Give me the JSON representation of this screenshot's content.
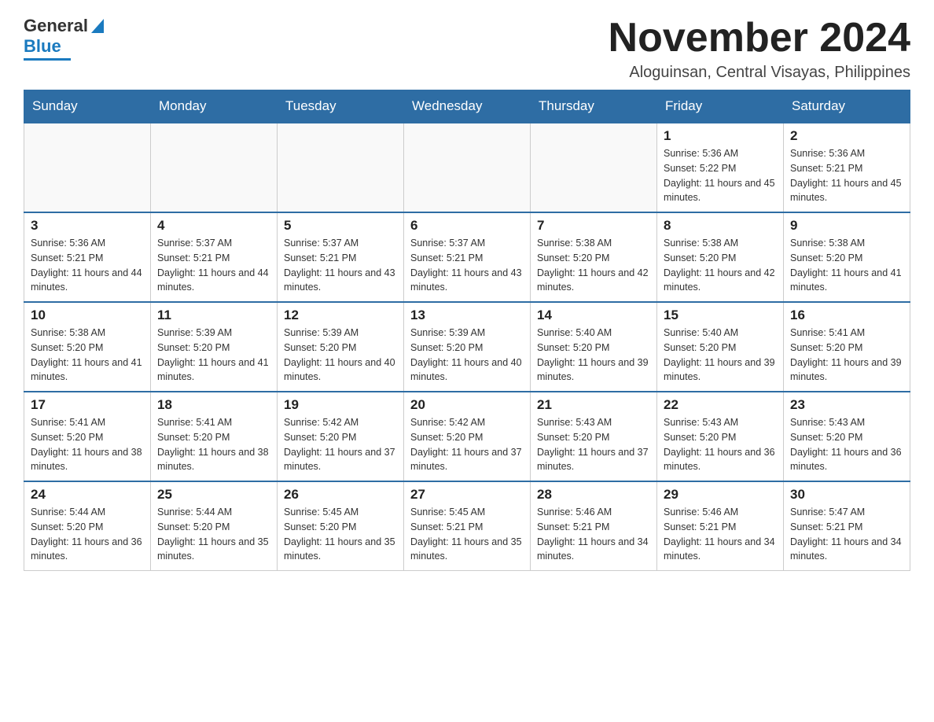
{
  "logo": {
    "general": "General",
    "blue": "Blue"
  },
  "header": {
    "month": "November 2024",
    "location": "Aloguinsan, Central Visayas, Philippines"
  },
  "days": [
    "Sunday",
    "Monday",
    "Tuesday",
    "Wednesday",
    "Thursday",
    "Friday",
    "Saturday"
  ],
  "weeks": [
    [
      {
        "day": "",
        "info": ""
      },
      {
        "day": "",
        "info": ""
      },
      {
        "day": "",
        "info": ""
      },
      {
        "day": "",
        "info": ""
      },
      {
        "day": "",
        "info": ""
      },
      {
        "day": "1",
        "info": "Sunrise: 5:36 AM\nSunset: 5:22 PM\nDaylight: 11 hours and 45 minutes."
      },
      {
        "day": "2",
        "info": "Sunrise: 5:36 AM\nSunset: 5:21 PM\nDaylight: 11 hours and 45 minutes."
      }
    ],
    [
      {
        "day": "3",
        "info": "Sunrise: 5:36 AM\nSunset: 5:21 PM\nDaylight: 11 hours and 44 minutes."
      },
      {
        "day": "4",
        "info": "Sunrise: 5:37 AM\nSunset: 5:21 PM\nDaylight: 11 hours and 44 minutes."
      },
      {
        "day": "5",
        "info": "Sunrise: 5:37 AM\nSunset: 5:21 PM\nDaylight: 11 hours and 43 minutes."
      },
      {
        "day": "6",
        "info": "Sunrise: 5:37 AM\nSunset: 5:21 PM\nDaylight: 11 hours and 43 minutes."
      },
      {
        "day": "7",
        "info": "Sunrise: 5:38 AM\nSunset: 5:20 PM\nDaylight: 11 hours and 42 minutes."
      },
      {
        "day": "8",
        "info": "Sunrise: 5:38 AM\nSunset: 5:20 PM\nDaylight: 11 hours and 42 minutes."
      },
      {
        "day": "9",
        "info": "Sunrise: 5:38 AM\nSunset: 5:20 PM\nDaylight: 11 hours and 41 minutes."
      }
    ],
    [
      {
        "day": "10",
        "info": "Sunrise: 5:38 AM\nSunset: 5:20 PM\nDaylight: 11 hours and 41 minutes."
      },
      {
        "day": "11",
        "info": "Sunrise: 5:39 AM\nSunset: 5:20 PM\nDaylight: 11 hours and 41 minutes."
      },
      {
        "day": "12",
        "info": "Sunrise: 5:39 AM\nSunset: 5:20 PM\nDaylight: 11 hours and 40 minutes."
      },
      {
        "day": "13",
        "info": "Sunrise: 5:39 AM\nSunset: 5:20 PM\nDaylight: 11 hours and 40 minutes."
      },
      {
        "day": "14",
        "info": "Sunrise: 5:40 AM\nSunset: 5:20 PM\nDaylight: 11 hours and 39 minutes."
      },
      {
        "day": "15",
        "info": "Sunrise: 5:40 AM\nSunset: 5:20 PM\nDaylight: 11 hours and 39 minutes."
      },
      {
        "day": "16",
        "info": "Sunrise: 5:41 AM\nSunset: 5:20 PM\nDaylight: 11 hours and 39 minutes."
      }
    ],
    [
      {
        "day": "17",
        "info": "Sunrise: 5:41 AM\nSunset: 5:20 PM\nDaylight: 11 hours and 38 minutes."
      },
      {
        "day": "18",
        "info": "Sunrise: 5:41 AM\nSunset: 5:20 PM\nDaylight: 11 hours and 38 minutes."
      },
      {
        "day": "19",
        "info": "Sunrise: 5:42 AM\nSunset: 5:20 PM\nDaylight: 11 hours and 37 minutes."
      },
      {
        "day": "20",
        "info": "Sunrise: 5:42 AM\nSunset: 5:20 PM\nDaylight: 11 hours and 37 minutes."
      },
      {
        "day": "21",
        "info": "Sunrise: 5:43 AM\nSunset: 5:20 PM\nDaylight: 11 hours and 37 minutes."
      },
      {
        "day": "22",
        "info": "Sunrise: 5:43 AM\nSunset: 5:20 PM\nDaylight: 11 hours and 36 minutes."
      },
      {
        "day": "23",
        "info": "Sunrise: 5:43 AM\nSunset: 5:20 PM\nDaylight: 11 hours and 36 minutes."
      }
    ],
    [
      {
        "day": "24",
        "info": "Sunrise: 5:44 AM\nSunset: 5:20 PM\nDaylight: 11 hours and 36 minutes."
      },
      {
        "day": "25",
        "info": "Sunrise: 5:44 AM\nSunset: 5:20 PM\nDaylight: 11 hours and 35 minutes."
      },
      {
        "day": "26",
        "info": "Sunrise: 5:45 AM\nSunset: 5:20 PM\nDaylight: 11 hours and 35 minutes."
      },
      {
        "day": "27",
        "info": "Sunrise: 5:45 AM\nSunset: 5:21 PM\nDaylight: 11 hours and 35 minutes."
      },
      {
        "day": "28",
        "info": "Sunrise: 5:46 AM\nSunset: 5:21 PM\nDaylight: 11 hours and 34 minutes."
      },
      {
        "day": "29",
        "info": "Sunrise: 5:46 AM\nSunset: 5:21 PM\nDaylight: 11 hours and 34 minutes."
      },
      {
        "day": "30",
        "info": "Sunrise: 5:47 AM\nSunset: 5:21 PM\nDaylight: 11 hours and 34 minutes."
      }
    ]
  ]
}
